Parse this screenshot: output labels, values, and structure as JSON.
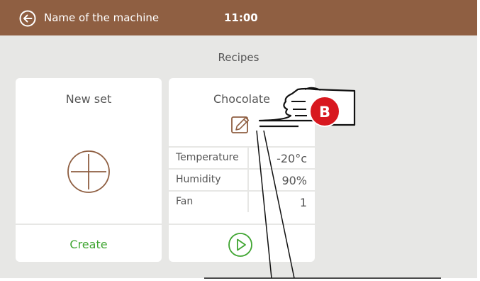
{
  "topbar": {
    "machine_name": "Name of the machine",
    "time": "11:00",
    "back_icon": "back-arrow-circle-icon"
  },
  "screen_title": "Recipes",
  "cards": {
    "new_set": {
      "title": "New set",
      "add_icon": "plus-circle-icon",
      "action_label": "Create"
    },
    "chocolate": {
      "title": "Chocolate",
      "edit_icon": "pencil-icon",
      "params": [
        {
          "label": "Temperature",
          "value": "-20°c"
        },
        {
          "label": "Humidity",
          "value": "90%"
        },
        {
          "label": "Fan",
          "value": "1"
        }
      ],
      "start_icon": "play-circle-icon"
    }
  },
  "callout": {
    "label": "B",
    "icon": "pointing-hand-icon"
  },
  "colors": {
    "topbar": "#8f5f42",
    "background": "#e7e7e5",
    "accent_brown": "#8f5f42",
    "accent_green": "#3fa531",
    "badge_red": "#d8181f"
  }
}
